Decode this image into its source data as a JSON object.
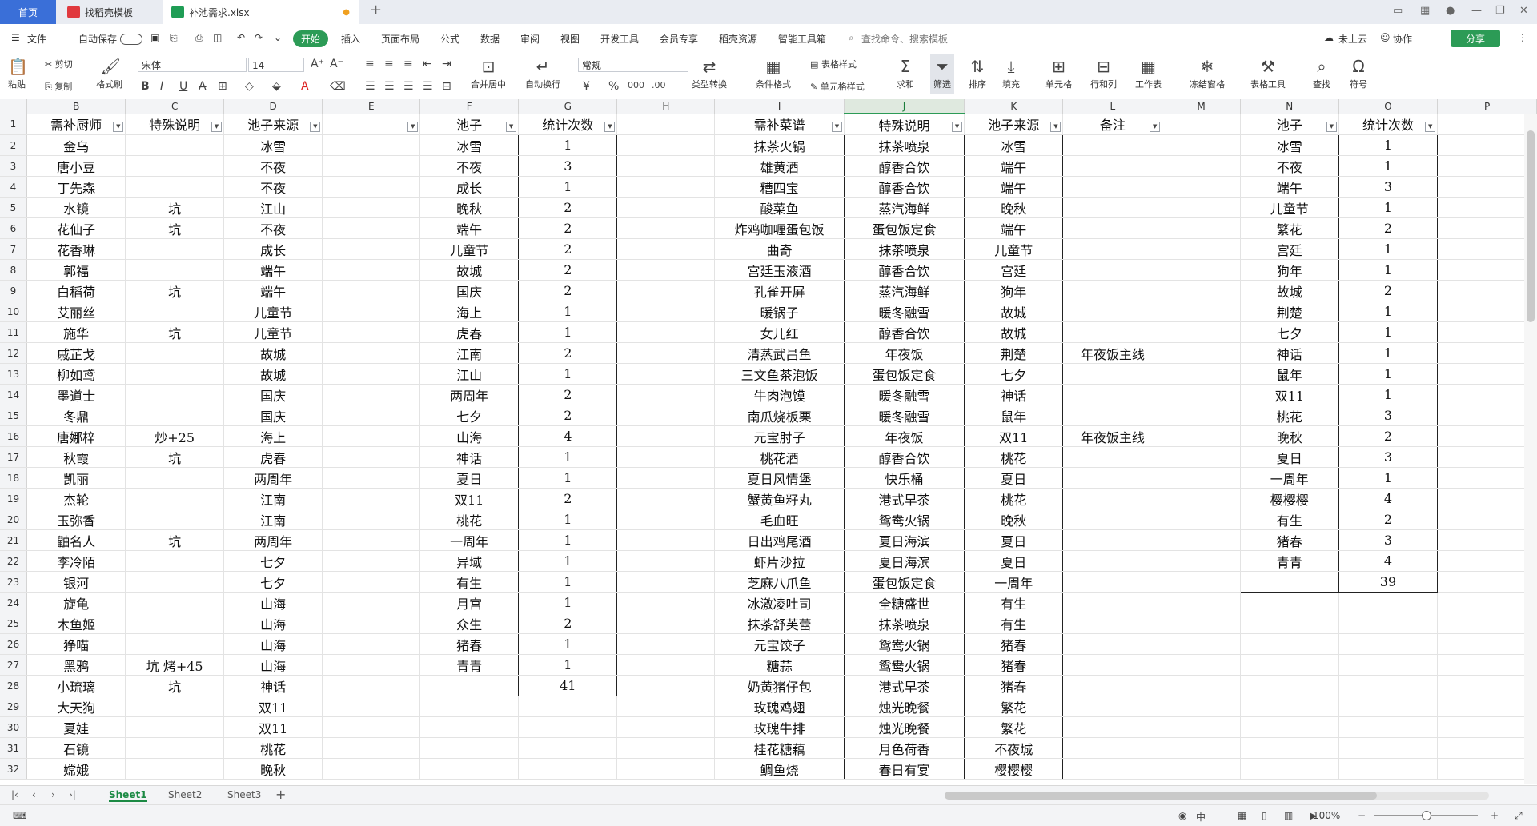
{
  "tabs": {
    "home": "首页",
    "template": "找稻壳模板",
    "file": "补池需求.xlsx"
  },
  "menu": {
    "file": "文件",
    "autosave": "自动保存",
    "start": "开始",
    "insert": "插入",
    "layout": "页面布局",
    "formula": "公式",
    "data": "数据",
    "review": "审阅",
    "view": "视图",
    "dev": "开发工具",
    "member": "会员专享",
    "dochub": "稻壳资源",
    "smart": "智能工具箱",
    "search": "查找命令、搜索模板",
    "cloud": "未上云",
    "collab": "协作",
    "share": "分享"
  },
  "toolbar": {
    "paste": "粘贴",
    "cut": "剪切",
    "copy": "复制",
    "format_painter": "格式刷",
    "font": "宋体",
    "size": "14",
    "numfmt": "常规",
    "merge": "合并居中",
    "wrap": "自动换行",
    "type_convert": "类型转换",
    "cond_format": "条件格式",
    "table_style": "表格样式",
    "cell_style": "单元格样式",
    "sum": "求和",
    "filter": "筛选",
    "sort": "排序",
    "fill": "填充",
    "cell": "单元格",
    "rowcol": "行和列",
    "worksheet": "工作表",
    "freeze": "冻结窗格",
    "table_tools": "表格工具",
    "find": "查找",
    "symbol": "符号"
  },
  "columns": [
    "B",
    "C",
    "D",
    "E",
    "F",
    "G",
    "H",
    "I",
    "J",
    "K",
    "L",
    "M",
    "N",
    "O",
    "P"
  ],
  "header_row": {
    "B": "需补厨师",
    "C": "特殊说明",
    "D": "池子来源",
    "E": "",
    "F": "池子",
    "G": "统计次数",
    "H": "",
    "I": "需补菜谱",
    "J": "特殊说明",
    "K": "池子来源",
    "L": "备注",
    "M": "",
    "N": "池子",
    "O": "统计次数",
    "P": ""
  },
  "rows": [
    [
      "金乌",
      "",
      "冰雪",
      "",
      "冰雪",
      "1",
      "",
      "抹茶火锅",
      "抹茶喷泉",
      "冰雪",
      "",
      "",
      "冰雪",
      "1",
      ""
    ],
    [
      "唐小豆",
      "",
      "不夜",
      "",
      "不夜",
      "3",
      "",
      "雄黄酒",
      "醇香合饮",
      "端午",
      "",
      "",
      "不夜",
      "1",
      ""
    ],
    [
      "丁先森",
      "",
      "不夜",
      "",
      "成长",
      "1",
      "",
      "糟四宝",
      "醇香合饮",
      "端午",
      "",
      "",
      "端午",
      "3",
      ""
    ],
    [
      "水镜",
      "坑",
      "江山",
      "",
      "晚秋",
      "2",
      "",
      "酸菜鱼",
      "蒸汽海鲜",
      "晚秋",
      "",
      "",
      "儿童节",
      "1",
      ""
    ],
    [
      "花仙子",
      "坑",
      "不夜",
      "",
      "端午",
      "2",
      "",
      "炸鸡咖喱蛋包饭",
      "蛋包饭定食",
      "端午",
      "",
      "",
      "繁花",
      "2",
      ""
    ],
    [
      "花香琳",
      "",
      "成长",
      "",
      "儿童节",
      "2",
      "",
      "曲奇",
      "抹茶喷泉",
      "儿童节",
      "",
      "",
      "宫廷",
      "1",
      ""
    ],
    [
      "郭福",
      "",
      "端午",
      "",
      "故城",
      "2",
      "",
      "宫廷玉液酒",
      "醇香合饮",
      "宫廷",
      "",
      "",
      "狗年",
      "1",
      ""
    ],
    [
      "白稻荷",
      "坑",
      "端午",
      "",
      "国庆",
      "2",
      "",
      "孔雀开屏",
      "蒸汽海鲜",
      "狗年",
      "",
      "",
      "故城",
      "2",
      ""
    ],
    [
      "艾丽丝",
      "",
      "儿童节",
      "",
      "海上",
      "1",
      "",
      "暖锅子",
      "暖冬融雪",
      "故城",
      "",
      "",
      "荆楚",
      "1",
      ""
    ],
    [
      "施华",
      "坑",
      "儿童节",
      "",
      "虎春",
      "1",
      "",
      "女儿红",
      "醇香合饮",
      "故城",
      "",
      "",
      "七夕",
      "1",
      ""
    ],
    [
      "戚芷戈",
      "",
      "故城",
      "",
      "江南",
      "2",
      "",
      "清蒸武昌鱼",
      "年夜饭",
      "荆楚",
      "年夜饭主线",
      "",
      "神话",
      "1",
      ""
    ],
    [
      "柳如鸢",
      "",
      "故城",
      "",
      "江山",
      "1",
      "",
      "三文鱼茶泡饭",
      "蛋包饭定食",
      "七夕",
      "",
      "",
      "鼠年",
      "1",
      ""
    ],
    [
      "墨道士",
      "",
      "国庆",
      "",
      "两周年",
      "2",
      "",
      "牛肉泡馍",
      "暖冬融雪",
      "神话",
      "",
      "",
      "双11",
      "1",
      ""
    ],
    [
      "冬鼎",
      "",
      "国庆",
      "",
      "七夕",
      "2",
      "",
      "南瓜烧板栗",
      "暖冬融雪",
      "鼠年",
      "",
      "",
      "桃花",
      "3",
      ""
    ],
    [
      "唐娜梓",
      "炒+25",
      "海上",
      "",
      "山海",
      "4",
      "",
      "元宝肘子",
      "年夜饭",
      "双11",
      "年夜饭主线",
      "",
      "晚秋",
      "2",
      ""
    ],
    [
      "秋霞",
      "坑",
      "虎春",
      "",
      "神话",
      "1",
      "",
      "桃花酒",
      "醇香合饮",
      "桃花",
      "",
      "",
      "夏日",
      "3",
      ""
    ],
    [
      "凯丽",
      "",
      "两周年",
      "",
      "夏日",
      "1",
      "",
      "夏日风情堡",
      "快乐桶",
      "夏日",
      "",
      "",
      "一周年",
      "1",
      ""
    ],
    [
      "杰轮",
      "",
      "江南",
      "",
      "双11",
      "2",
      "",
      "蟹黄鱼籽丸",
      "港式早茶",
      "桃花",
      "",
      "",
      "樱樱樱",
      "4",
      ""
    ],
    [
      "玉弥香",
      "",
      "江南",
      "",
      "桃花",
      "1",
      "",
      "毛血旺",
      "鸳鸯火锅",
      "晚秋",
      "",
      "",
      "有生",
      "2",
      ""
    ],
    [
      "鼬名人",
      "坑",
      "两周年",
      "",
      "一周年",
      "1",
      "",
      "日出鸡尾酒",
      "夏日海滨",
      "夏日",
      "",
      "",
      "猪春",
      "3",
      ""
    ],
    [
      "李冷陌",
      "",
      "七夕",
      "",
      "异域",
      "1",
      "",
      "虾片沙拉",
      "夏日海滨",
      "夏日",
      "",
      "",
      "青青",
      "4",
      ""
    ],
    [
      "银河",
      "",
      "七夕",
      "",
      "有生",
      "1",
      "",
      "芝麻八爪鱼",
      "蛋包饭定食",
      "一周年",
      "",
      "",
      "",
      "39",
      ""
    ],
    [
      "旋龟",
      "",
      "山海",
      "",
      "月宫",
      "1",
      "",
      "冰激凌吐司",
      "全糖盛世",
      "有生",
      "",
      "",
      "",
      "",
      ""
    ],
    [
      "木鱼姬",
      "",
      "山海",
      "",
      "众生",
      "2",
      "",
      "抹茶舒芙蕾",
      "抹茶喷泉",
      "有生",
      "",
      "",
      "",
      "",
      ""
    ],
    [
      "狰喵",
      "",
      "山海",
      "",
      "猪春",
      "1",
      "",
      "元宝饺子",
      "鸳鸯火锅",
      "猪春",
      "",
      "",
      "",
      "",
      ""
    ],
    [
      "黑鸦",
      "坑 烤+45",
      "山海",
      "",
      "青青",
      "1",
      "",
      "糖蒜",
      "鸳鸯火锅",
      "猪春",
      "",
      "",
      "",
      "",
      ""
    ],
    [
      "小琉璃",
      "坑",
      "神话",
      "",
      "",
      "41",
      "",
      "奶黄猪仔包",
      "港式早茶",
      "猪春",
      "",
      "",
      "",
      "",
      ""
    ],
    [
      "大天狗",
      "",
      "双11",
      "",
      "",
      "",
      "",
      "玫瑰鸡翅",
      "烛光晚餐",
      "繁花",
      "",
      "",
      "",
      "",
      ""
    ],
    [
      "夏娃",
      "",
      "双11",
      "",
      "",
      "",
      "",
      "玫瑰牛排",
      "烛光晚餐",
      "繁花",
      "",
      "",
      "",
      "",
      ""
    ],
    [
      "石镜",
      "",
      "桃花",
      "",
      "",
      "",
      "",
      "桂花糖藕",
      "月色荷香",
      "不夜城",
      "",
      "",
      "",
      "",
      ""
    ],
    [
      "嫦娥",
      "",
      "晚秋",
      "",
      "",
      "",
      "",
      "鲷鱼烧",
      "春日有宴",
      "樱樱樱",
      "",
      "",
      "",
      "",
      ""
    ]
  ],
  "sheets": [
    "Sheet1",
    "Sheet2",
    "Sheet3"
  ],
  "status": {
    "zoom": "100%"
  }
}
